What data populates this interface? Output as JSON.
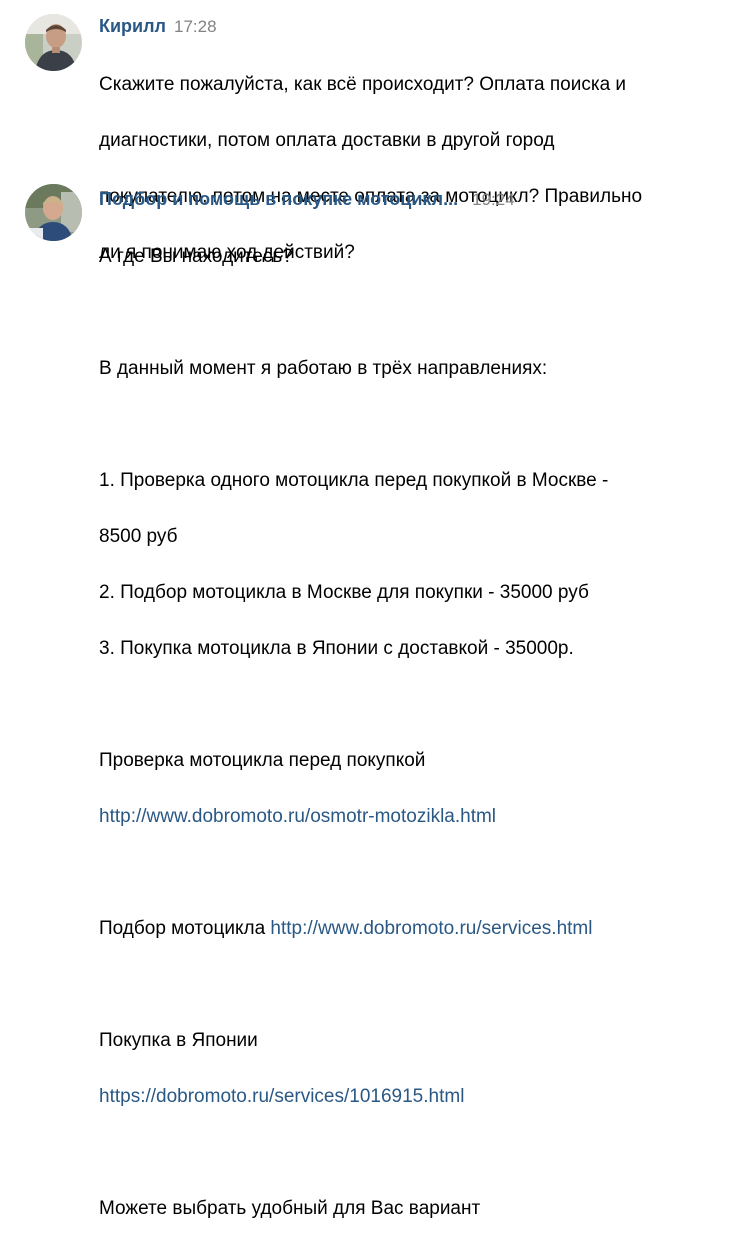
{
  "messages": [
    {
      "author": "Кирилл",
      "time": "17:28",
      "lines": [
        "Скажите пожалуйста, как всё происходит? Оплата поиска и",
        "диагностики, потом оплата доставки в другой город",
        "покупателю, потом на месте оплата за мотоцикл? Правильно",
        "ли я понимаю ход действий?"
      ]
    },
    {
      "author": "Подбор и помощь в покупке мотоцикл...",
      "time": "19:24",
      "greeting": "А где Вы находитесь?",
      "intro": "В данный момент я работаю в трёх направлениях:",
      "list": [
        "1. Проверка одного мотоцикла перед покупкой в Москве -",
        "8500 руб",
        "2. Подбор мотоцикла в Москве для покупки - 35000 руб",
        "3. Покупка мотоцикла в Японии с доставкой - 35000р."
      ],
      "check_label": "Проверка мотоцикла перед покупкой",
      "check_link": "http://www.dobromoto.ru/osmotr-motozikla.html",
      "select_label": "Подбор мотоцикла",
      "select_link": "http://www.dobromoto.ru/services.html",
      "japan_label": "Покупка в Японии",
      "japan_link": "https://dobromoto.ru/services/1016915.html",
      "closing": "Можете выбрать удобный для Вас вариант"
    }
  ],
  "colors": {
    "link": "#2a5885",
    "time": "#828282",
    "text": "#000000"
  }
}
